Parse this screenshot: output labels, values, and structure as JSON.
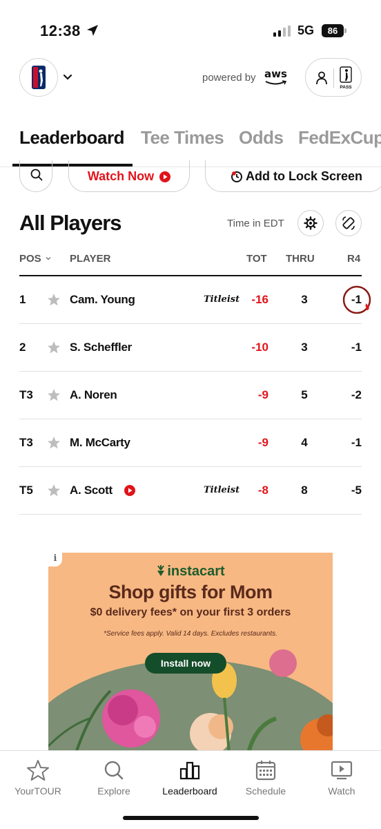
{
  "status_bar": {
    "time": "12:38",
    "network": "5G",
    "battery": "86"
  },
  "header": {
    "powered_by": "powered by",
    "aws_label": "aws"
  },
  "tabs": [
    {
      "label": "Leaderboard"
    },
    {
      "label": "Tee Times"
    },
    {
      "label": "Odds"
    },
    {
      "label": "FedExCup"
    }
  ],
  "actions": {
    "watch_now": "Watch Now",
    "lock_screen": "Add to Lock Screen"
  },
  "section": {
    "title": "All Players",
    "time_zone": "Time in EDT"
  },
  "table": {
    "columns": {
      "pos": "POS",
      "player": "PLAYER",
      "tot": "TOT",
      "thru": "THRU",
      "r4": "R4"
    },
    "rows": [
      {
        "pos": "1",
        "name": "Cam. Young",
        "sponsor": "Titleist",
        "tot": "-16",
        "thru": "3",
        "r4": "-1"
      },
      {
        "pos": "2",
        "name": "S. Scheffler",
        "sponsor": "",
        "tot": "-10",
        "thru": "3",
        "r4": "-1"
      },
      {
        "pos": "T3",
        "name": "A. Noren",
        "sponsor": "",
        "tot": "-9",
        "thru": "5",
        "r4": "-2"
      },
      {
        "pos": "T3",
        "name": "M. McCarty",
        "sponsor": "",
        "tot": "-9",
        "thru": "4",
        "r4": "-1"
      },
      {
        "pos": "T5",
        "name": "A. Scott",
        "sponsor": "Titleist",
        "tot": "-8",
        "thru": "8",
        "r4": "-5"
      }
    ]
  },
  "ad": {
    "info": "i",
    "brand": "instacart",
    "headline": "Shop gifts for Mom",
    "subline": "$0 delivery fees* on your first 3 orders",
    "fine_print": "*Service fees apply. Valid 14 days. Excludes restaurants.",
    "cta": "Install now"
  },
  "bottom_nav": [
    {
      "label": "YourTOUR",
      "icon": "star-icon"
    },
    {
      "label": "Explore",
      "icon": "search-icon"
    },
    {
      "label": "Leaderboard",
      "icon": "leaderboard-icon"
    },
    {
      "label": "Schedule",
      "icon": "calendar-icon"
    },
    {
      "label": "Watch",
      "icon": "tv-play-icon"
    }
  ],
  "colors": {
    "accent_red": "#e1131a",
    "text": "#111111",
    "muted": "#9a9a9a",
    "ad_bg": "#f7b883",
    "ad_green": "#144d2a"
  }
}
